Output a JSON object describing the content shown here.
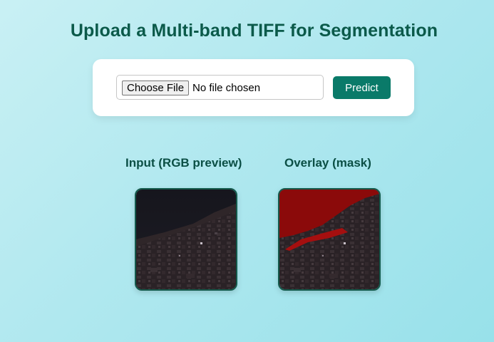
{
  "header": {
    "title": "Upload a Multi-band TIFF for Segmentation"
  },
  "upload": {
    "choose_label": "Choose File",
    "file_status": "No file chosen",
    "predict_label": "Predict"
  },
  "results": {
    "input_label": "Input (RGB preview)",
    "overlay_label": "Overlay (mask)"
  },
  "colors": {
    "accent": "#0a7a69",
    "title": "#0b5a4a",
    "mask": "#8b0a0a"
  }
}
